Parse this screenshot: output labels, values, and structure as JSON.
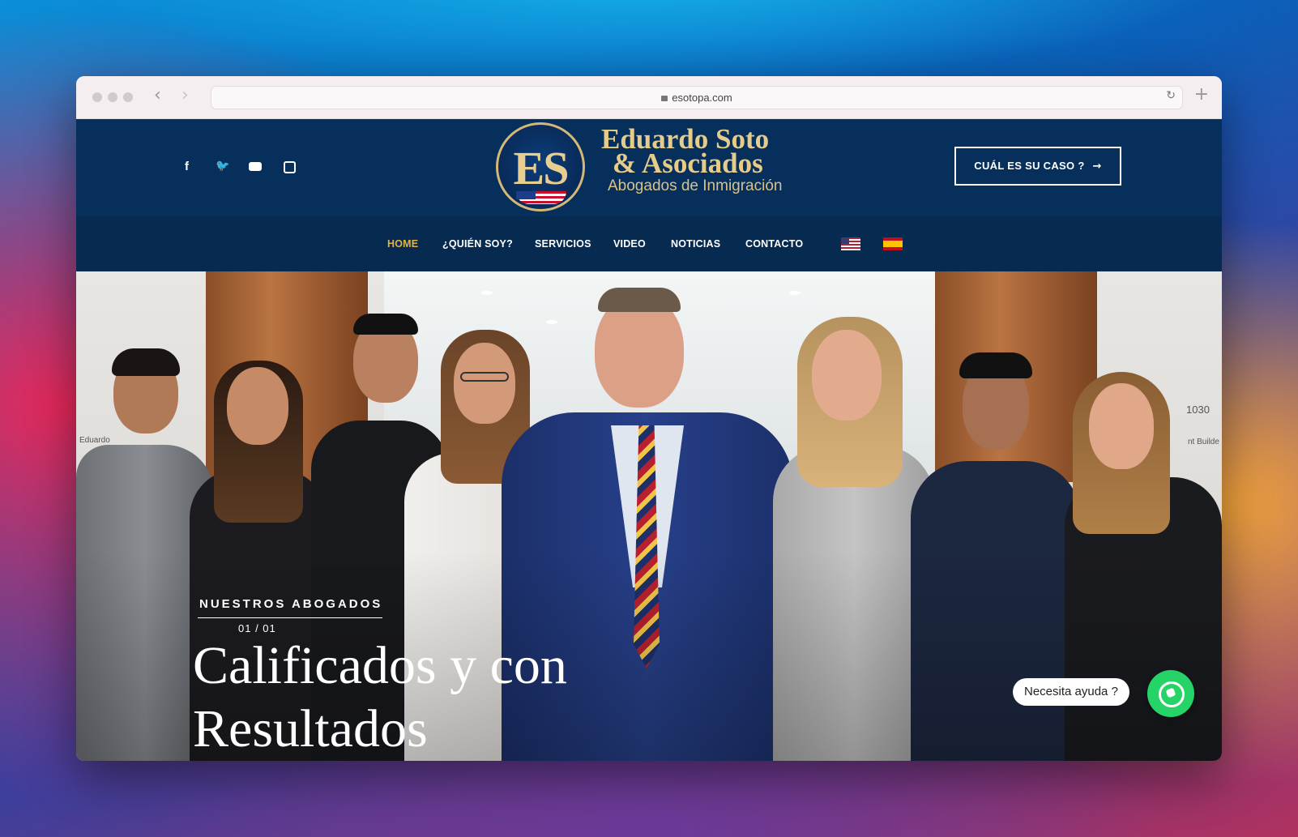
{
  "browser": {
    "url": "esotopa.com"
  },
  "header": {
    "logo": {
      "initials": "ES",
      "line1": "Eduardo Soto",
      "line2": "& Asociados",
      "line3": "Abogados de Inmigración"
    },
    "social": [
      "facebook-icon",
      "twitter-icon",
      "youtube-icon",
      "instagram-icon"
    ],
    "cta_label": "CUÁL ES SU CASO ?",
    "cta_arrow": "→"
  },
  "nav": {
    "items": [
      {
        "label": "HOME",
        "active": true
      },
      {
        "label": "¿QUIÉN SOY?"
      },
      {
        "label": "SERVICIOS"
      },
      {
        "label": "VIDEO"
      },
      {
        "label": "NOTICIAS"
      },
      {
        "label": "CONTACTO"
      }
    ],
    "languages": [
      "english-flag-icon",
      "spanish-flag-icon"
    ]
  },
  "hero": {
    "eyebrow": "NUESTROS ABOGADOS",
    "counter": "01 / 01",
    "headline": "Calificados y con Resultados",
    "sign_left": "Eduardo",
    "sign_right_number": "1030",
    "sign_right_text": "nt Builde"
  },
  "chat": {
    "label": "Necesita ayuda ?"
  },
  "colors": {
    "header_bg": "#072f5c",
    "nav_active": "#e3b24a",
    "gold": "#e6cc8a",
    "whatsapp": "#25d366"
  }
}
